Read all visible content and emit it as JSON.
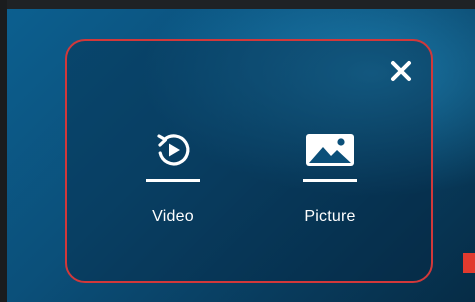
{
  "dialog": {
    "close_icon": "close-icon",
    "options": [
      {
        "label": "Video",
        "icon": "video-replay-icon"
      },
      {
        "label": "Picture",
        "icon": "picture-icon"
      }
    ]
  },
  "colors": {
    "accent_border": "#d2383a",
    "text": "#ffffff",
    "background_blue": "#0b4f79",
    "marker_red": "#e23a2e"
  }
}
